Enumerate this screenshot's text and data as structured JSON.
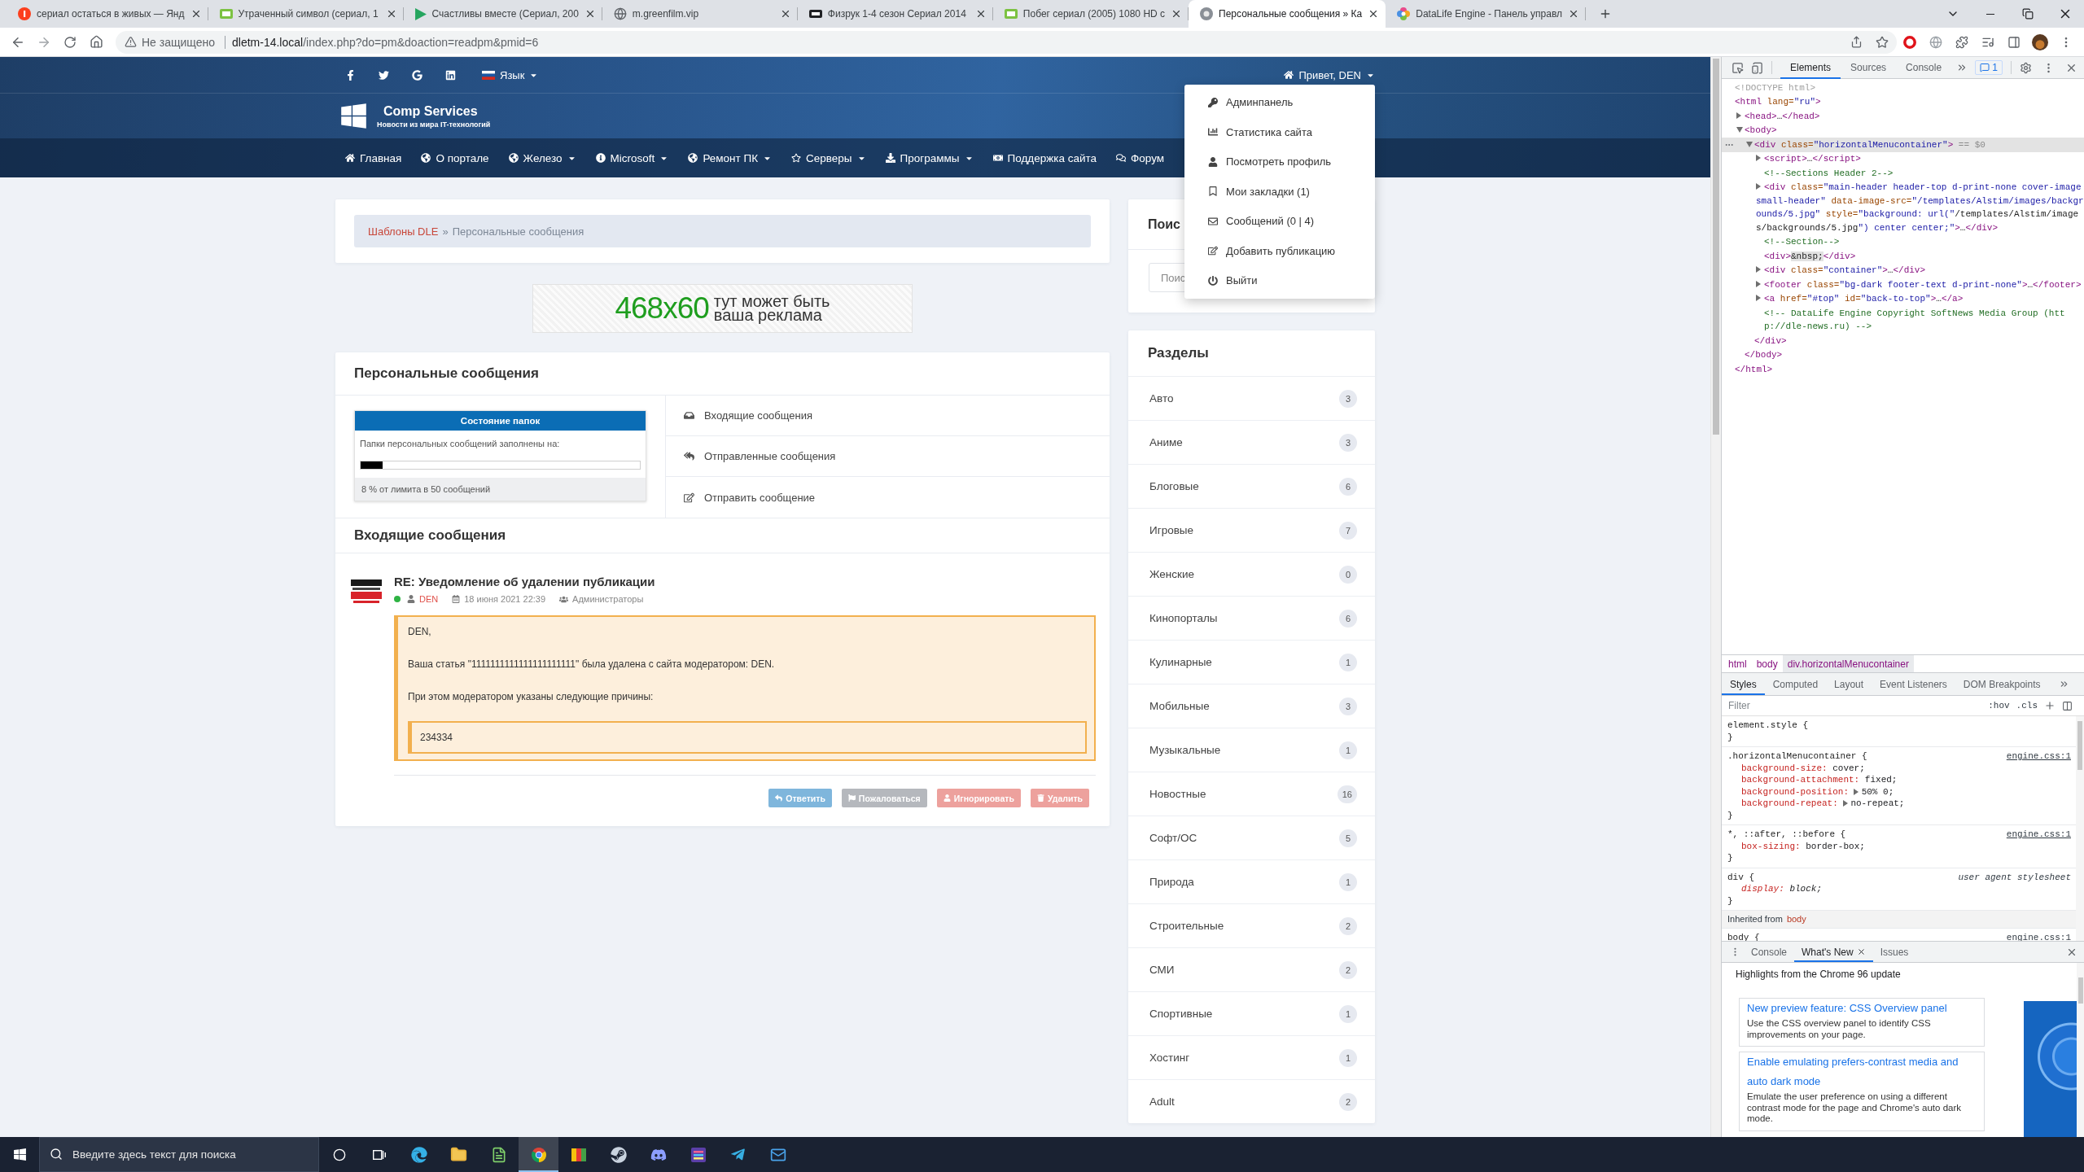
{
  "browser": {
    "tabs": [
      {
        "title": "сериал остаться в живых — Янд",
        "selected": false
      },
      {
        "title": "Утраченный символ (сериал, 1",
        "selected": false
      },
      {
        "title": "Счастливы вместе (Сериал, 200",
        "selected": false
      },
      {
        "title": "m.greenfilm.vip",
        "selected": false
      },
      {
        "title": "Физрук 1-4 сезон Сериал 2014",
        "selected": false
      },
      {
        "title": "Побег сериал (2005) 1080 HD с",
        "selected": false
      },
      {
        "title": "Персональные сообщения » Ка",
        "selected": true
      },
      {
        "title": "DataLife Engine - Панель управл",
        "selected": false
      }
    ],
    "address": {
      "security": "Не защищено",
      "host": "dletm-14.local",
      "path": "/index.php?do=pm&doaction=readpm&pmid=6"
    }
  },
  "site": {
    "language": "Язык",
    "greeting": "Привет, DEN",
    "brand": {
      "name": "Comp Services",
      "tagline": "Новости из мира IT-технологий"
    },
    "nav": [
      {
        "label": "Главная",
        "dropdown": false
      },
      {
        "label": "О портале",
        "dropdown": false
      },
      {
        "label": "Железо",
        "dropdown": true
      },
      {
        "label": "Microsoft",
        "dropdown": true
      },
      {
        "label": "Ремонт ПК",
        "dropdown": true
      },
      {
        "label": "Серверы",
        "dropdown": true
      },
      {
        "label": "Программы",
        "dropdown": true
      },
      {
        "label": "Поддержка сайта",
        "dropdown": false
      },
      {
        "label": "Форум",
        "dropdown": false
      }
    ],
    "user_menu": {
      "expanded": true,
      "items": [
        "Админпанель",
        "Статистика сайта",
        "Посмотреть профиль",
        "Мои закладки (1)",
        "Сообщений (0 | 4)",
        "Добавить публикацию",
        "Выйти"
      ]
    },
    "breadcrumbs": {
      "items": [
        "Шаблоны DLE",
        "Персональные сообщения"
      ],
      "separator": "»"
    },
    "ad": {
      "size": "468x60",
      "lines": [
        "тут может быть",
        "ваша реклама"
      ]
    },
    "pm": {
      "title": "Персональные сообщения",
      "folder_status": {
        "title": "Состояние папок",
        "label": "Папки персональных сообщений заполнены на:",
        "level": 0.08,
        "note": "8 % от лимита в 50 сообщений"
      },
      "folders": [
        "Входящие сообщения",
        "Отправленные сообщения",
        "Отправить сообщение"
      ],
      "inbox_title": "Входящие сообщения",
      "message": {
        "subject": "RE: Уведомление об удалении публикации",
        "online": true,
        "author": "DEN",
        "date": "18 июня 2021 22:39",
        "group": "Администраторы",
        "paragraphs": [
          "DEN,",
          "Ваша статья \"1111111111111111111111\" была удалена с сайта модератором: DEN.",
          "При этом модератором указаны следующие причины:"
        ],
        "quote": "234334"
      },
      "actions": [
        {
          "label": "Ответить",
          "kind": "reply"
        },
        {
          "label": "Пожаловаться",
          "kind": "complain"
        },
        {
          "label": "Игнорировать",
          "kind": "ignore"
        },
        {
          "label": "Удалить",
          "kind": "delete"
        }
      ]
    },
    "search": {
      "title": "Поис",
      "placeholder": "Поис"
    },
    "categories": {
      "title": "Разделы",
      "items": [
        {
          "name": "Авто",
          "count": "3"
        },
        {
          "name": "Аниме",
          "count": "3"
        },
        {
          "name": "Блоговые",
          "count": "6"
        },
        {
          "name": "Игровые",
          "count": "7"
        },
        {
          "name": "Женские",
          "count": "0"
        },
        {
          "name": "Кинопорталы",
          "count": "6"
        },
        {
          "name": "Кулинарные",
          "count": "1"
        },
        {
          "name": "Мобильные",
          "count": "3"
        },
        {
          "name": "Музыкальные",
          "count": "1"
        },
        {
          "name": "Новостные",
          "count": "16"
        },
        {
          "name": "Софт/ОС",
          "count": "5"
        },
        {
          "name": "Природа",
          "count": "1"
        },
        {
          "name": "Строительные",
          "count": "2"
        },
        {
          "name": "СМИ",
          "count": "2"
        },
        {
          "name": "Спортивные",
          "count": "1"
        },
        {
          "name": "Хостинг",
          "count": "1"
        },
        {
          "name": "Adult",
          "count": "2"
        }
      ]
    }
  },
  "devtools": {
    "tabs": [
      {
        "label": "Elements",
        "selected": true
      },
      {
        "label": "Sources",
        "selected": false
      },
      {
        "label": "Console",
        "selected": false
      }
    ],
    "issues": "1",
    "dom": [
      {
        "kind": "doctype",
        "text": "<!DOCTYPE html>",
        "selected": false
      },
      {
        "kind": "root",
        "text": "<html lang=\"ru\">",
        "close": "</html>",
        "selected": false,
        "children": [
          {
            "kind": "container",
            "text": "<head>…</head>",
            "expanded": false,
            "selected": false
          },
          {
            "kind": "container",
            "text": "<body>",
            "close": "</body>",
            "expanded": true,
            "selected": false,
            "children": [
              {
                "kind": "container",
                "text": "<div class=\"horizontalMenucontainer\">",
                "marker": "== $0",
                "close": "</div>",
                "expanded": true,
                "selected": true,
                "children": [
                  {
                    "kind": "container",
                    "text": "<script>…</script>",
                    "expanded": false,
                    "selected": false
                  },
                  {
                    "kind": "comment",
                    "text": "<!--Sections Header 2-->",
                    "selected": false
                  },
                  {
                    "kind": "container",
                    "text": "<div class=\"main-header header-top d-print-none cover-image small-header\" data-image-src=\"/templates/Alstim/images/backgrounds/5.jpg\" style=\"background: url(\"/templates/Alstim/images/backgrounds/5.jpg\") center center;\">…</div>",
                    "expanded": false,
                    "selected": false
                  },
                  {
                    "kind": "comment",
                    "text": "<!--Section-->",
                    "selected": false
                  },
                  {
                    "kind": "leaf",
                    "text": "<div>&nbsp;</div>",
                    "selected": false
                  },
                  {
                    "kind": "container",
                    "text": "<div class=\"container\">…</div>",
                    "expanded": false,
                    "selected": false
                  },
                  {
                    "kind": "container",
                    "text": "<footer class=\"bg-dark footer-text d-print-none\">…</footer>",
                    "expanded": false,
                    "selected": false
                  },
                  {
                    "kind": "container",
                    "text": "<a href=\"#top\" id=\"back-to-top\">…</a>",
                    "expanded": false,
                    "selected": false
                  },
                  {
                    "kind": "comment",
                    "text": "<!-- DataLife Engine Copyright SoftNews Media Group (http://dle-news.ru) -->",
                    "selected": false
                  }
                ]
              }
            ]
          }
        ]
      }
    ],
    "path": [
      {
        "label": "html",
        "selected": false
      },
      {
        "label": "body",
        "selected": false
      },
      {
        "label": "div.horizontalMenucontainer",
        "selected": true
      }
    ],
    "pane_tabs": [
      {
        "label": "Styles",
        "selected": true
      },
      {
        "label": "Computed",
        "selected": false
      },
      {
        "label": "Layout",
        "selected": false
      },
      {
        "label": "Event Listeners",
        "selected": false
      },
      {
        "label": "DOM Breakpoints",
        "selected": false
      }
    ],
    "filter_placeholder": "Filter",
    "hov": ":hov",
    "cls": ".cls",
    "rules": [
      {
        "kind": "author",
        "selector": "element.style {",
        "close": "}"
      },
      {
        "kind": "author",
        "selector": ".horizontalMenucontainer {",
        "source": "engine.css:1",
        "close": "}",
        "props": [
          {
            "name": "background-size:",
            "value": "cover;"
          },
          {
            "name": "background-attachment:",
            "value": "fixed;"
          },
          {
            "name": "background-position:",
            "value": "50% 0;",
            "expandable": true
          },
          {
            "name": "background-repeat:",
            "value": "no-repeat;",
            "expandable": true
          }
        ]
      },
      {
        "kind": "author",
        "selector": "*, ::after, ::before {",
        "source": "engine.css:1",
        "close": "}",
        "props": [
          {
            "name": "box-sizing:",
            "value": "border-box;"
          }
        ]
      },
      {
        "kind": "user-agent",
        "selector": "div {",
        "source": "user agent stylesheet",
        "close": "}",
        "props": [
          {
            "name": "display:",
            "value": "block;"
          }
        ]
      },
      {
        "kind": "inherited",
        "label": "Inherited from",
        "element": "body"
      },
      {
        "kind": "author",
        "selector": "body {",
        "source": "engine.css:1"
      }
    ],
    "drawer": {
      "tabs": [
        {
          "label": "Console",
          "selected": false,
          "closable": false
        },
        {
          "label": "What's New",
          "selected": true,
          "closable": true
        },
        {
          "label": "Issues",
          "selected": false,
          "closable": false
        }
      ],
      "headline": "Highlights from the Chrome 96 update",
      "cards": [
        {
          "title": "New preview feature: CSS Overview panel",
          "text": "Use the CSS overview panel to identify CSS improvements on your page."
        },
        {
          "title": "Enable emulating prefers-contrast media and auto dark mode",
          "text": "Emulate the user preference on using a different contrast mode for the page and Chrome's auto dark mode."
        }
      ]
    }
  },
  "taskbar": {
    "search_placeholder": "Введите здесь текст для поиска",
    "apps": [
      {
        "selected": false
      },
      {
        "selected": false
      },
      {
        "selected": false
      },
      {
        "selected": true
      },
      {
        "selected": false
      },
      {
        "selected": false
      },
      {
        "selected": false
      },
      {
        "selected": false
      },
      {
        "selected": false
      },
      {
        "selected": false
      }
    ]
  }
}
